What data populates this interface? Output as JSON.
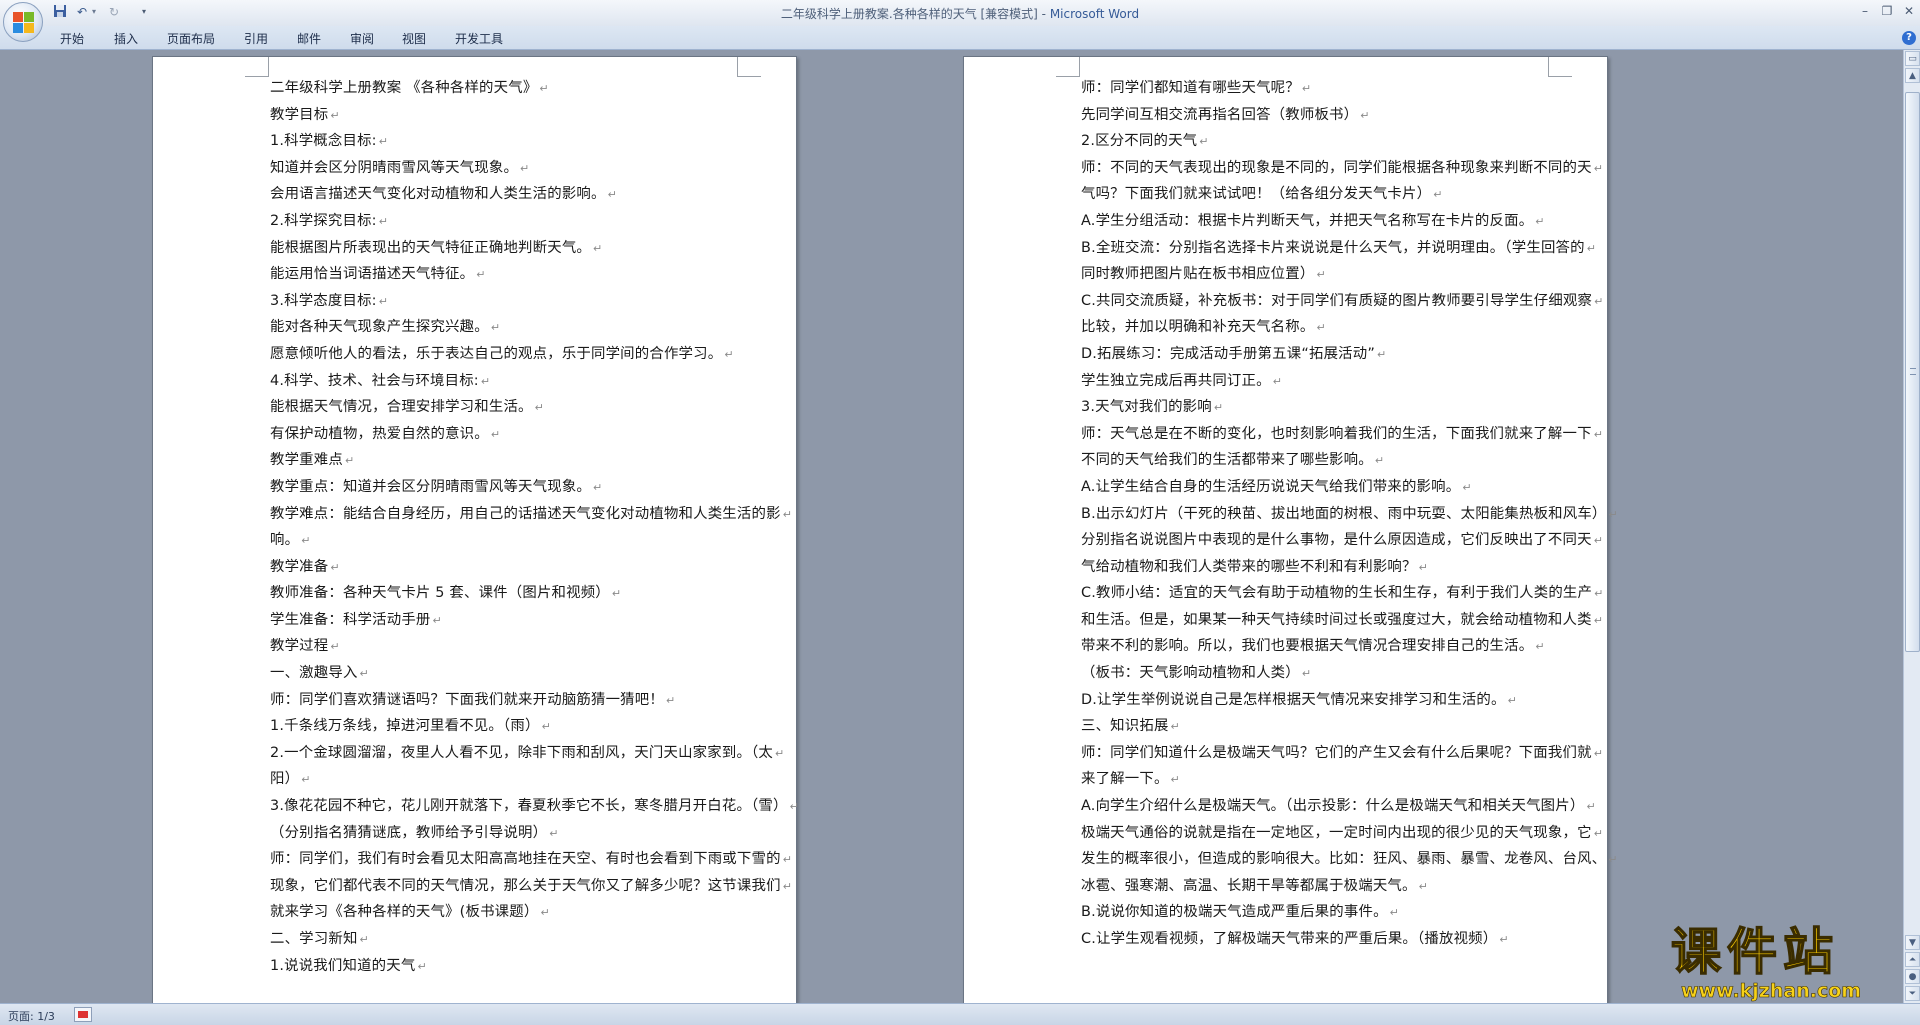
{
  "window": {
    "title": "二年级科学上册教案.各种各样的天气 [兼容模式] - ",
    "app_name": "Microsoft Word"
  },
  "ribbon": {
    "tabs": [
      "开始",
      "插入",
      "页面布局",
      "引用",
      "邮件",
      "审阅",
      "视图",
      "开发工具"
    ]
  },
  "status": {
    "page": "页面: 1/3"
  },
  "pages": {
    "left": [
      "二年级科学上册教案 《各种各样的天气》",
      "教学目标",
      "1.科学概念目标:",
      "知道并会区分阴晴雨雪风等天气现象。",
      "会用语言描述天气变化对动植物和人类生活的影响。",
      "2.科学探究目标:",
      "能根据图片所表现出的天气特征正确地判断天气。",
      "能运用恰当词语描述天气特征。",
      "3.科学态度目标:",
      "能对各种天气现象产生探究兴趣。",
      "愿意倾听他人的看法，乐于表达自己的观点，乐于同学间的合作学习。",
      "4.科学、技术、社会与环境目标:",
      "能根据天气情况，合理安排学习和生活。",
      "有保护动植物，热爱自然的意识。",
      "教学重难点",
      "教学重点：知道并会区分阴晴雨雪风等天气现象。",
      "教学难点：能结合自身经历，用自己的话描述天气变化对动植物和人类生活的影",
      "响。",
      "教学准备",
      "教师准备：各种天气卡片 5 套、课件（图片和视频）",
      "学生准备：科学活动手册",
      "教学过程",
      "一、激趣导入",
      "师：同学们喜欢猜谜语吗？下面我们就来开动脑筋猜一猜吧！",
      "1.千条线万条线，掉进河里看不见。（雨）",
      "2.一个金球圆溜溜，夜里人人看不见，除非下雨和刮风，天门天山家家到。（太",
      "阳）",
      "3.像花花园不种它，花儿刚开就落下，春夏秋季它不长，寒冬腊月开白花。（雪）",
      "（分别指名猜猜谜底，教师给予引导说明）",
      "师：同学们，我们有时会看见太阳高高地挂在天空、有时也会看到下雨或下雪的",
      "现象，它们都代表不同的天气情况，那么关于天气你又了解多少呢？这节课我们",
      "就来学习《各种各样的天气》(板书课题）",
      "二、学习新知",
      "1.说说我们知道的天气"
    ],
    "right": [
      "师：同学们都知道有哪些天气呢？",
      "先同学间互相交流再指名回答（教师板书）",
      "2.区分不同的天气",
      "师：不同的天气表现出的现象是不同的，同学们能根据各种现象来判断不同的天",
      "气吗？下面我们就来试试吧！（给各组分发天气卡片）",
      "A.学生分组活动：根据卡片判断天气，并把天气名称写在卡片的反面。",
      "B.全班交流：分别指名选择卡片来说说是什么天气，并说明理由。（学生回答的",
      "同时教师把图片贴在板书相应位置）",
      "C.共同交流质疑，补充板书：对于同学们有质疑的图片教师要引导学生仔细观察",
      "比较，并加以明确和补充天气名称。",
      "D.拓展练习：完成活动手册第五课“拓展活动”",
      "学生独立完成后再共同订正。",
      "3.天气对我们的影响",
      "师：天气总是在不断的变化，也时刻影响着我们的生活，下面我们就来了解一下",
      "不同的天气给我们的生活都带来了哪些影响。",
      "A.让学生结合自身的生活经历说说天气给我们带来的影响。",
      "B.出示幻灯片（干死的秧苗、拔出地面的树根、雨中玩耍、太阳能集热板和风车）",
      "分别指名说说图片中表现的是什么事物，是什么原因造成，它们反映出了不同天",
      "气给动植物和我们人类带来的哪些不利和有利影响？",
      "C.教师小结：适宜的天气会有助于动植物的生长和生存，有利于我们人类的生产",
      "和生活。但是，如果某一种天气持续时间过长或强度过大，就会给动植物和人类",
      "带来不利的影响。所以，我们也要根据天气情况合理安排自己的生活。",
      "（板书：天气影响动植物和人类）",
      "D.让学生举例说说自己是怎样根据天气情况来安排学习和生活的。",
      "三、知识拓展",
      "师：同学们知道什么是极端天气吗？它们的产生又会有什么后果呢？下面我们就",
      "来了解一下。",
      "A.向学生介绍什么是极端天气。（出示投影：什么是极端天气和相关天气图片）",
      "极端天气通俗的说就是指在一定地区，一定时间内出现的很少见的天气现象，它",
      "发生的概率很小，但造成的影响很大。比如：狂风、暴雨、暴雪、龙卷风、台风、",
      "冰雹、强寒潮、高温、长期干旱等都属于极端天气。",
      "B.说说你知道的极端天气造成严重后果的事件。",
      "C.让学生观看视频，了解极端天气带来的严重后果。（播放视频）"
    ]
  },
  "watermark": {
    "title": "课件站",
    "url": "www.kjzhan.com"
  },
  "colors": {
    "workspace": "#8e98a9",
    "watermark": "#f2c400",
    "ribbon": "#dde7f3"
  },
  "icons": [
    "office-button-icon",
    "save-icon",
    "undo-icon",
    "redo-icon",
    "customize-qat-icon",
    "minimize-icon",
    "restore-icon",
    "close-icon",
    "help-icon",
    "scroll-up-icon",
    "scroll-down-icon",
    "prev-page-icon",
    "next-page-icon",
    "language-icon"
  ]
}
